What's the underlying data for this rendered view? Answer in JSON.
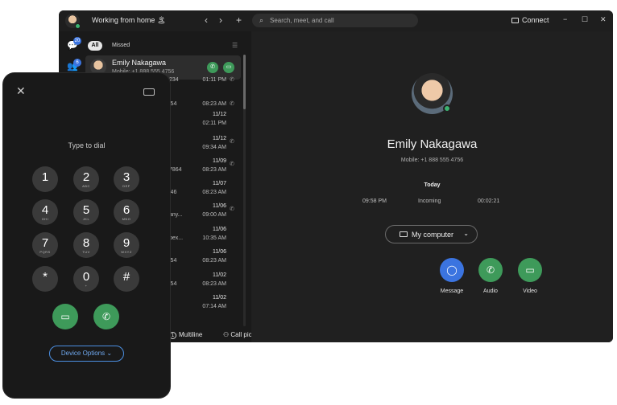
{
  "titlebar": {
    "status": "Working from home 🏝",
    "search_placeholder": "Search, meet, and call",
    "connect": "Connect",
    "back": "‹",
    "forward": "›",
    "add": "+",
    "minimize": "−",
    "maximize": "☐",
    "close": "✕"
  },
  "rail": {
    "badge_messages": "20",
    "badge_teams": "6"
  },
  "filters": {
    "all": "All",
    "missed": "Missed"
  },
  "selected": {
    "name": "Emily Nakagawa",
    "sub": "Mobile: +1 888 555 4756"
  },
  "history": [
    {
      "partial": "234",
      "date": "",
      "time": "01:11 PM"
    },
    {
      "partial": "i54",
      "date": "",
      "time": "08:23 AM"
    },
    {
      "partial": "",
      "date": "11/12",
      "time": "02:11 PM"
    },
    {
      "partial": "",
      "date": "11/12",
      "time": "09:34 AM"
    },
    {
      "partial": "7864",
      "date": "11/09",
      "time": "08:23 AM"
    },
    {
      "partial": "i46",
      "date": "11/07",
      "time": "08:23 AM"
    },
    {
      "partial": "any...",
      "date": "11/06",
      "time": "09:00 AM"
    },
    {
      "partial": "bex...",
      "date": "11/06",
      "time": "10:35 AM"
    },
    {
      "partial": "i54",
      "date": "11/06",
      "time": "08:23 AM"
    },
    {
      "partial": "i54",
      "date": "11/02",
      "time": "08:23 AM"
    },
    {
      "partial": "",
      "date": "11/02",
      "time": "07:14 AM"
    }
  ],
  "bottom": {
    "multiline": "Multiline",
    "pickup": "Call pickup"
  },
  "detail": {
    "name": "Emily Nakagawa",
    "mobile": "Mobile: +1 888 555 4756",
    "today": "Today",
    "time": "09:58 PM",
    "direction": "Incoming",
    "duration": "00:02:21",
    "device": "My computer",
    "actions": {
      "message": "Message",
      "audio": "Audio",
      "video": "Video"
    }
  },
  "dialpad": {
    "prompt": "Type to dial",
    "keys": [
      {
        "d": "1",
        "l": ""
      },
      {
        "d": "2",
        "l": "ABC"
      },
      {
        "d": "3",
        "l": "DEF"
      },
      {
        "d": "4",
        "l": "GHI"
      },
      {
        "d": "5",
        "l": "JKL"
      },
      {
        "d": "6",
        "l": "MNO"
      },
      {
        "d": "7",
        "l": "PQRS"
      },
      {
        "d": "8",
        "l": "TUV"
      },
      {
        "d": "9",
        "l": "WXYZ"
      },
      {
        "d": "*",
        "l": ""
      },
      {
        "d": "0",
        "l": "+"
      },
      {
        "d": "#",
        "l": ""
      }
    ],
    "device_options": "Device Options ⌄"
  },
  "colors": {
    "green": "#3e9a5a",
    "blue": "#3b74e0",
    "bg": "#1a1a1a"
  }
}
